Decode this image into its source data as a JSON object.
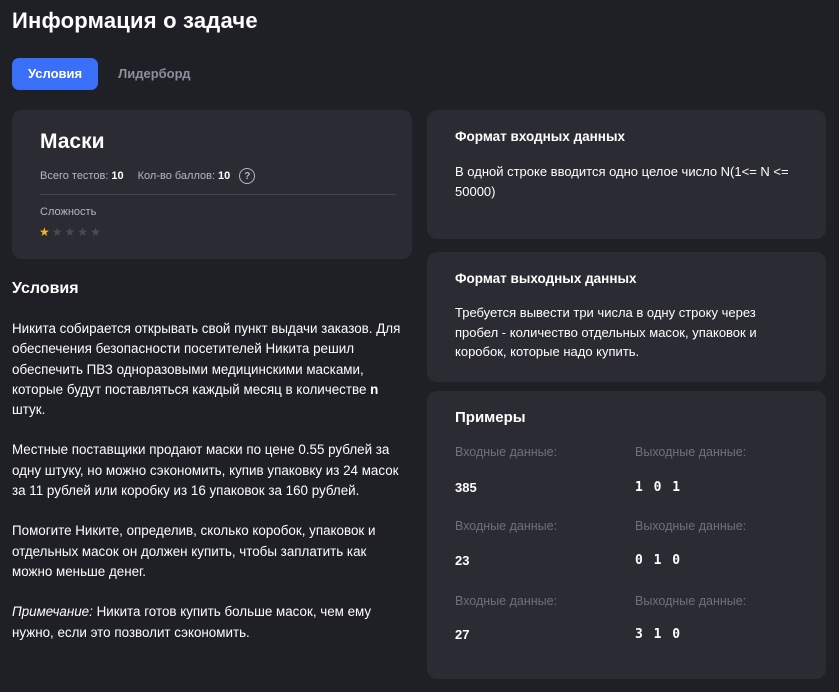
{
  "page_title": "Информация о задаче",
  "tabs": [
    {
      "label": "Условия",
      "active": true
    },
    {
      "label": "Лидерборд",
      "active": false
    }
  ],
  "task": {
    "name": "Маски",
    "tests_label": "Всего тестов:",
    "tests_value": "10",
    "points_label": "Кол-во баллов:",
    "points_value": "10",
    "help_glyph": "?",
    "difficulty_label": "Сложность",
    "difficulty_stars": 1,
    "difficulty_max": 5
  },
  "conditions": {
    "title": "Условия",
    "p1": "Никита собирается открывать свой пункт выдачи заказов. Для обеспечения безопасности посетителей Никита решил обеспечить ПВЗ одноразовыми медицинскими масками, которые будут поставляться каждый месяц в количестве",
    "p1_var": "n",
    "p1_end": "штук.",
    "p2": "Местные поставщики продают маски по цене 0.55 рублей за одну штуку, но можно сэкономить, купив упаковку из 24 масок за 11 рублей или коробку из 16 упаковок за 160 рублей.",
    "p3": "Помогите Никите, определив, сколько коробок, упаковок и отдельных масок он должен купить, чтобы заплатить как можно меньше денег.",
    "note_label": "Примечание:",
    "note_text": "Никита готов купить больше масок, чем ему нужно, если это позволит сэкономить."
  },
  "input_format": {
    "title": "Формат входных данных",
    "text": "В одной строке вводится одно целое число N(1<= N <= 50000)"
  },
  "output_format": {
    "title": "Формат выходных данных",
    "text": "Требуется вывести три числа в одну строку через пробел - количество отдельных масок, упаковок и коробок, которые надо купить."
  },
  "examples": {
    "title": "Примеры",
    "input_label": "Входные данные:",
    "output_label": "Выходные данные:",
    "items": [
      {
        "input": "385",
        "output": "1 0 1"
      },
      {
        "input": "23",
        "output": "0 1 0"
      },
      {
        "input": "27",
        "output": "3 1 0"
      }
    ]
  },
  "colors": {
    "background": "#1f1f26",
    "card": "#2b2b33",
    "accent": "#3a6ff7",
    "star_filled": "#f3b324",
    "star_empty": "#4a4a55",
    "muted": "#6e707c"
  }
}
